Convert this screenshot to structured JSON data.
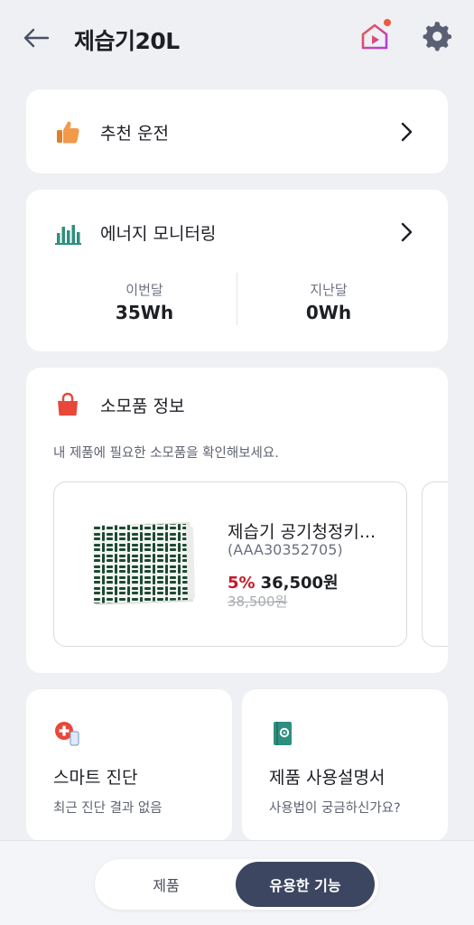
{
  "header": {
    "title": "제습기20L",
    "back_icon": "arrow-left-icon",
    "play_icon": "home-play-icon",
    "settings_icon": "gear-icon",
    "notification_dot_color": "#f05a3c"
  },
  "recommend": {
    "label": "추천 운전",
    "icon": "thumbs-up-icon"
  },
  "energy": {
    "label": "에너지 모니터링",
    "icon": "bar-chart-icon",
    "this_month_label": "이번달",
    "this_month_value": "35Wh",
    "last_month_label": "지난달",
    "last_month_value": "0Wh"
  },
  "consumables": {
    "label": "소모품 정보",
    "icon": "shopping-bag-icon",
    "description": "내 제품에 필요한 소모품을 확인해보세요.",
    "product": {
      "name": "제습기 공기청정키...",
      "code": "(AAA30352705)",
      "discount": "5%",
      "price": "36,500원",
      "original_price": "38,500원"
    }
  },
  "smart_diagnosis": {
    "title": "스마트 진단",
    "subtitle": "최근 진단 결과 없음",
    "icon": "diagnosis-icon"
  },
  "manual": {
    "title": "제품 사용설명서",
    "subtitle": "사용법이 궁금하신가요?",
    "icon": "manual-book-icon"
  },
  "bottom_nav": {
    "tab_product": "제품",
    "tab_useful": "유용한 기능",
    "active": "유용한 기능"
  },
  "colors": {
    "background": "#eef0f4",
    "accent_dark": "#3d4660",
    "discount_red": "#c41a2a",
    "energy_teal": "#2f8f7e",
    "bag_red": "#e8473a",
    "thumb_orange": "#f2994a"
  }
}
